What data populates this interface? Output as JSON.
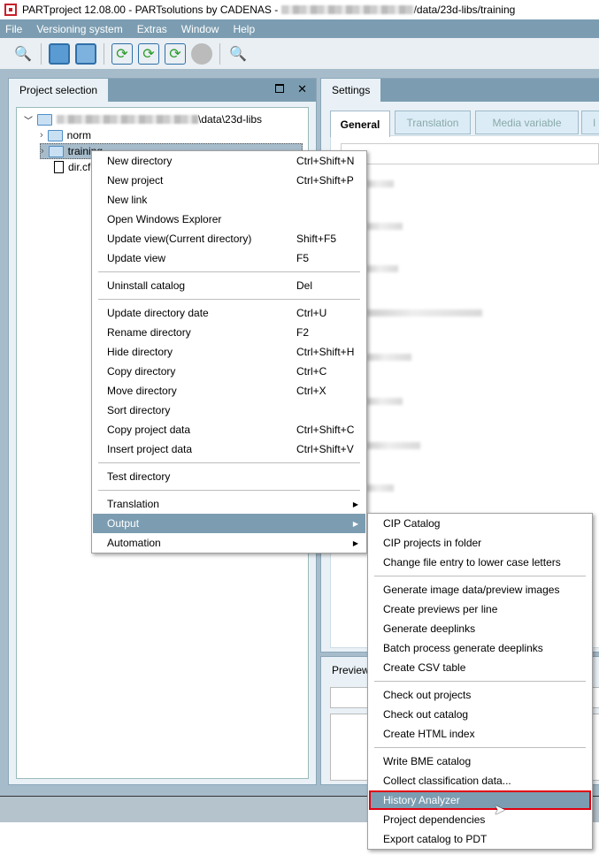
{
  "title": {
    "prefix": "PARTproject 12.08.00 - PARTsolutions by CADENAS - ",
    "suffix": "/data/23d-libs/training"
  },
  "menu": [
    "File",
    "Versioning system",
    "Extras",
    "Window",
    "Help"
  ],
  "toolbar": [
    "search-text-icon",
    "save-icon",
    "save-all-icon",
    "update-view-icon",
    "update-search-icon",
    "update-cycle-icon",
    "globe-icon",
    "search-lock-icon"
  ],
  "left_panel": {
    "title": "Project selection",
    "tree": {
      "root": "\\data\\23d-libs",
      "items": [
        "norm",
        "training",
        "dir.cfg"
      ]
    }
  },
  "right_panel": {
    "title": "Settings",
    "tabs": [
      "General",
      "Translation",
      "Media variable",
      "I"
    ],
    "preview_title": "Preview"
  },
  "context_menu": [
    {
      "label": "New directory",
      "shortcut": "Ctrl+Shift+N"
    },
    {
      "label": "New project",
      "shortcut": "Ctrl+Shift+P"
    },
    {
      "label": "New link",
      "shortcut": ""
    },
    {
      "label": "Open Windows Explorer",
      "shortcut": ""
    },
    {
      "label": "Update view(Current directory)",
      "shortcut": "Shift+F5"
    },
    {
      "label": "Update view",
      "shortcut": "F5"
    },
    {
      "sep": true
    },
    {
      "label": "Uninstall catalog",
      "shortcut": "Del"
    },
    {
      "sep": true
    },
    {
      "label": "Update directory date",
      "shortcut": "Ctrl+U"
    },
    {
      "label": "Rename directory",
      "shortcut": "F2"
    },
    {
      "label": "Hide directory",
      "shortcut": "Ctrl+Shift+H"
    },
    {
      "label": "Copy directory",
      "shortcut": "Ctrl+C"
    },
    {
      "label": "Move directory",
      "shortcut": "Ctrl+X"
    },
    {
      "label": "Sort directory",
      "shortcut": ""
    },
    {
      "label": "Copy project data",
      "shortcut": "Ctrl+Shift+C"
    },
    {
      "label": "Insert project data",
      "shortcut": "Ctrl+Shift+V"
    },
    {
      "sep": true
    },
    {
      "label": "Test directory",
      "shortcut": ""
    },
    {
      "sep": true
    },
    {
      "label": "Translation",
      "submenu": true
    },
    {
      "label": "Output",
      "submenu": true,
      "active": true
    },
    {
      "label": "Automation",
      "submenu": true
    }
  ],
  "submenu": [
    {
      "label": "CIP Catalog"
    },
    {
      "label": "CIP projects in folder"
    },
    {
      "label": "Change file entry to lower case letters"
    },
    {
      "sep": true
    },
    {
      "label": "Generate image data/preview images"
    },
    {
      "label": "Create previews per line"
    },
    {
      "label": "Generate deeplinks"
    },
    {
      "label": "Batch process generate deeplinks"
    },
    {
      "label": "Create CSV table"
    },
    {
      "sep": true
    },
    {
      "label": "Check out projects"
    },
    {
      "label": "Check out catalog"
    },
    {
      "label": "Create HTML index"
    },
    {
      "sep": true
    },
    {
      "label": "Write BME catalog"
    },
    {
      "label": "Collect classification data..."
    },
    {
      "label": "History Analyzer",
      "active": true
    },
    {
      "label": "Project dependencies"
    },
    {
      "label": "Export catalog to PDT"
    }
  ],
  "colors": {
    "accent": "#7c9db1",
    "highlight_border": "#e0000f"
  }
}
